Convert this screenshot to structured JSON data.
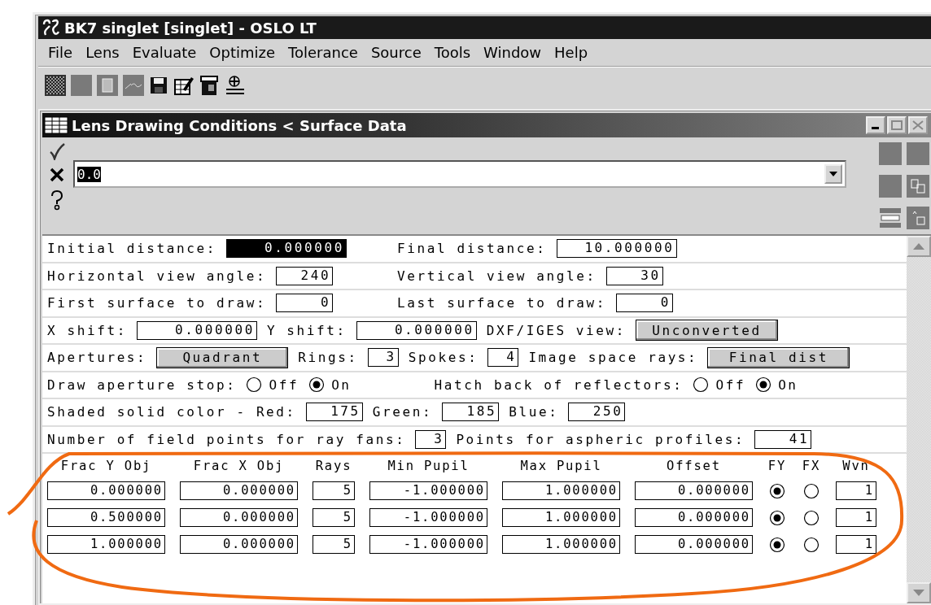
{
  "window": {
    "title": "BK7 singlet [singlet] - OSLO LT"
  },
  "menu": [
    {
      "label": "File"
    },
    {
      "label": "Lens"
    },
    {
      "label": "Evaluate"
    },
    {
      "label": "Optimize"
    },
    {
      "label": "Tolerance"
    },
    {
      "label": "Source"
    },
    {
      "label": "Tools"
    },
    {
      "label": "Window"
    },
    {
      "label": "Help"
    }
  ],
  "child_window": {
    "title": "Lens Drawing Conditions < Surface Data"
  },
  "command": {
    "value": "0.0"
  },
  "form_rows": [
    {
      "left": [
        {
          "kind": "label",
          "text": "Initial distance:"
        },
        {
          "kind": "field",
          "text": "0.000000",
          "selected": true
        }
      ],
      "right": [
        {
          "kind": "label",
          "text": "Final distance:"
        },
        {
          "kind": "field",
          "text": "10.000000",
          "selected": false
        }
      ]
    },
    {
      "left": [
        {
          "kind": "label",
          "text": "Horizontal view angle:"
        },
        {
          "kind": "field",
          "text": "240",
          "selected": false
        }
      ],
      "right": [
        {
          "kind": "label",
          "text": "Vertical view angle:"
        },
        {
          "kind": "field",
          "text": "30",
          "selected": false
        }
      ]
    },
    {
      "left": [
        {
          "kind": "label",
          "text": "First surface to draw:"
        },
        {
          "kind": "field",
          "text": "0",
          "selected": false
        }
      ],
      "right": [
        {
          "kind": "label",
          "text": "Last surface to draw:"
        },
        {
          "kind": "field",
          "text": "0",
          "selected": false
        }
      ]
    },
    {
      "items": [
        {
          "kind": "label",
          "text": "X shift:"
        },
        {
          "kind": "field",
          "text": "0.000000",
          "selected": false
        },
        {
          "kind": "label",
          "text": "Y shift:"
        },
        {
          "kind": "field",
          "text": "0.000000",
          "selected": false
        },
        {
          "kind": "label",
          "text": "DXF/IGES view:"
        },
        {
          "kind": "button",
          "text": "Unconverted"
        }
      ]
    },
    {
      "items": [
        {
          "kind": "label",
          "text": "Apertures:"
        },
        {
          "kind": "button",
          "text": "Quadrant"
        },
        {
          "kind": "label",
          "text": "Rings:"
        },
        {
          "kind": "field",
          "text": "3",
          "selected": false
        },
        {
          "kind": "label",
          "text": "Spokes:"
        },
        {
          "kind": "field",
          "text": "4",
          "selected": false
        },
        {
          "kind": "label",
          "text": "Image space rays:"
        },
        {
          "kind": "button",
          "text": "Final dist"
        }
      ]
    },
    {
      "items": [
        {
          "kind": "label",
          "text": "Draw aperture stop:"
        },
        {
          "kind": "radio",
          "text": "Off",
          "selected": false
        },
        {
          "kind": "radio",
          "text": "On",
          "selected": true
        },
        {
          "kind": "label",
          "text": "Hatch back of reflectors:"
        },
        {
          "kind": "radio",
          "text": "Off",
          "selected": false
        },
        {
          "kind": "radio",
          "text": "On",
          "selected": true
        }
      ]
    },
    {
      "items": [
        {
          "kind": "label",
          "text": "Shaded solid color - Red:"
        },
        {
          "kind": "field",
          "text": "175",
          "selected": false
        },
        {
          "kind": "label",
          "text": "Green:"
        },
        {
          "kind": "field",
          "text": "185",
          "selected": false
        },
        {
          "kind": "label",
          "text": "Blue:"
        },
        {
          "kind": "field",
          "text": "250",
          "selected": false
        }
      ]
    },
    {
      "items": [
        {
          "kind": "label",
          "text": "Number of field points for ray fans:"
        },
        {
          "kind": "field",
          "text": "3",
          "selected": false
        },
        {
          "kind": "label",
          "text": "Points for aspheric profiles:"
        },
        {
          "kind": "field",
          "text": "41",
          "selected": false
        }
      ]
    }
  ],
  "table": {
    "columns": [
      "Frac Y Obj",
      "Frac X Obj",
      "Rays",
      "Min Pupil",
      "Max Pupil",
      "Offset",
      "FY",
      "FX",
      "Wvn"
    ],
    "rows": [
      {
        "cells": [
          "0.000000",
          "0.000000",
          "5",
          "-1.000000",
          "1.000000",
          "0.000000"
        ],
        "fy": true,
        "fx": false,
        "wvn": "1"
      },
      {
        "cells": [
          "0.500000",
          "0.000000",
          "5",
          "-1.000000",
          "1.000000",
          "0.000000"
        ],
        "fy": true,
        "fx": false,
        "wvn": "1"
      },
      {
        "cells": [
          "1.000000",
          "0.000000",
          "5",
          "-1.000000",
          "1.000000",
          "0.000000"
        ],
        "fy": true,
        "fx": false,
        "wvn": "1"
      }
    ]
  }
}
